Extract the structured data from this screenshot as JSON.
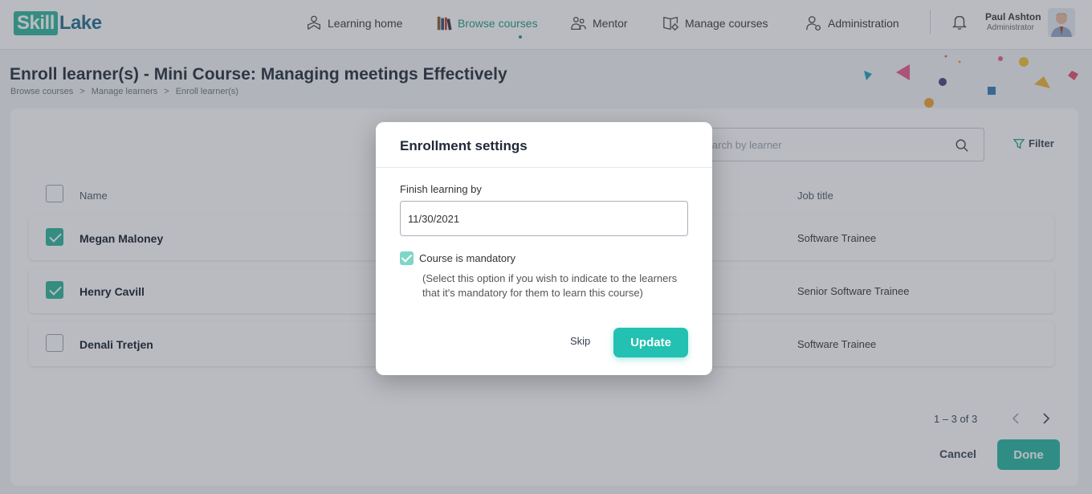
{
  "app": {
    "logo_part1": "Skill",
    "logo_part2": "Lake",
    "brand_color": "#2bb39a",
    "logo_color": "#1f6b8e"
  },
  "nav": {
    "items": [
      {
        "label": "Learning home",
        "icon": "learning-home-icon"
      },
      {
        "label": "Browse courses",
        "icon": "books-icon",
        "active": true
      },
      {
        "label": "Mentor",
        "icon": "mentor-icon"
      },
      {
        "label": "Manage courses",
        "icon": "manage-courses-icon"
      },
      {
        "label": "Administration",
        "icon": "administration-icon"
      }
    ]
  },
  "user": {
    "name": "Paul Ashton",
    "role": "Administrator"
  },
  "page": {
    "title": "Enroll learner(s) - Mini Course: Managing meetings Effectively",
    "breadcrumb": [
      "Browse courses",
      "Manage learners",
      "Enroll learner(s)"
    ],
    "breadcrumb_sep": ">"
  },
  "search": {
    "placeholder": "Search by learner"
  },
  "filter": {
    "label": "Filter"
  },
  "table": {
    "columns": {
      "name": "Name",
      "job": "Job title"
    },
    "rows": [
      {
        "name": "Megan Maloney",
        "job": "Software Trainee",
        "checked": true
      },
      {
        "name": "Henry Cavill",
        "job": "Senior Software Trainee",
        "checked": true
      },
      {
        "name": "Denali Tretjen",
        "job": "Software Trainee",
        "checked": false
      }
    ]
  },
  "pagination": {
    "range": "1 – 3 of 3"
  },
  "actions": {
    "cancel": "Cancel",
    "done": "Done"
  },
  "modal": {
    "title": "Enrollment settings",
    "finish_label": "Finish learning by",
    "finish_value": "11/30/2021",
    "mandatory_label": "Course is mandatory",
    "mandatory_checked": true,
    "mandatory_help": "(Select this option if you wish to indicate to the learners that it's mandatory for them to learn this course)",
    "skip": "Skip",
    "update": "Update"
  }
}
